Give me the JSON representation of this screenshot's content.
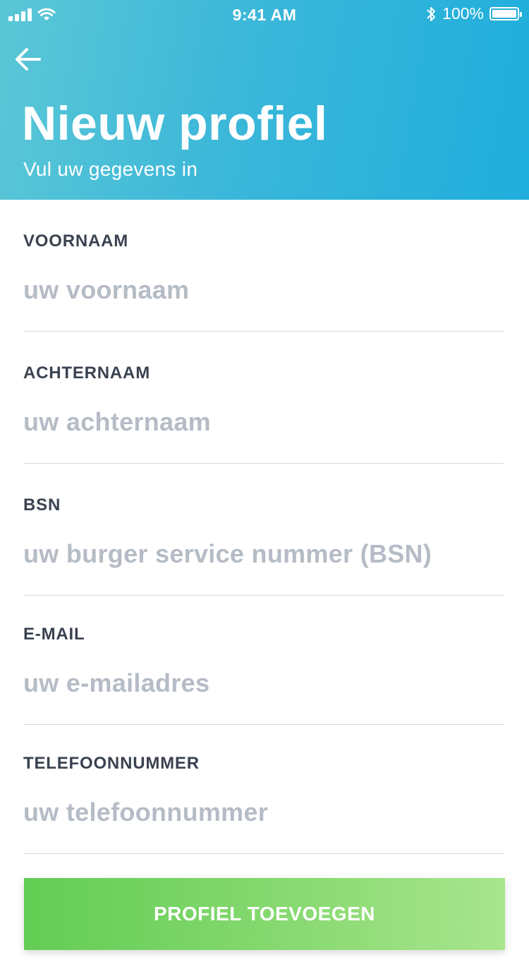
{
  "status_bar": {
    "time": "9:41 AM",
    "battery": "100%"
  },
  "header": {
    "title": "Nieuw profiel",
    "subtitle": "Vul uw gegevens in"
  },
  "fields": [
    {
      "label": "VOORNAAM",
      "placeholder": "uw voornaam",
      "value": ""
    },
    {
      "label": "ACHTERNAAM",
      "placeholder": "uw achternaam",
      "value": ""
    },
    {
      "label": "BSN",
      "placeholder": "uw burger service nummer (BSN)",
      "value": ""
    },
    {
      "label": "E-MAIL",
      "placeholder": "uw e-mailadres",
      "value": ""
    },
    {
      "label": "TELEFOONNUMMER",
      "placeholder": "uw telefoonnummer",
      "value": ""
    }
  ],
  "submit_label": "PROFIEL TOEVOEGEN",
  "colors": {
    "header_gradient_start": "#5bc7d6",
    "header_gradient_end": "#1faedc",
    "button_gradient_start": "#62cd53",
    "button_gradient_end": "#a8e58d",
    "label_text": "#3a4250",
    "placeholder_text": "#b5bcc6"
  },
  "icons": {
    "back": "arrow-left-icon",
    "signal": "signal-icon",
    "wifi": "wifi-icon",
    "bluetooth": "bluetooth-icon",
    "battery": "battery-icon"
  }
}
